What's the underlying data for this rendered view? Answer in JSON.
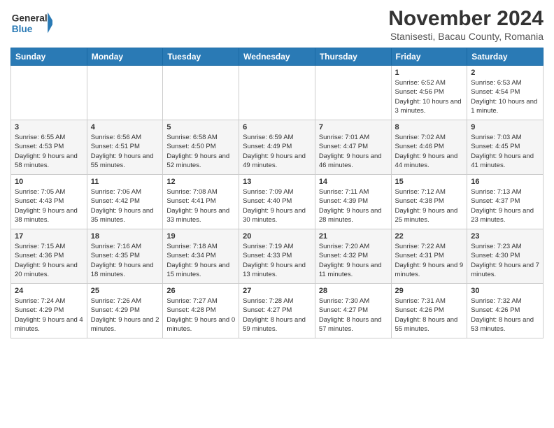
{
  "logo": {
    "line1": "General",
    "line2": "Blue"
  },
  "title": "November 2024",
  "subtitle": "Stanisesti, Bacau County, Romania",
  "days_of_week": [
    "Sunday",
    "Monday",
    "Tuesday",
    "Wednesday",
    "Thursday",
    "Friday",
    "Saturday"
  ],
  "weeks": [
    [
      {
        "day": "",
        "info": ""
      },
      {
        "day": "",
        "info": ""
      },
      {
        "day": "",
        "info": ""
      },
      {
        "day": "",
        "info": ""
      },
      {
        "day": "",
        "info": ""
      },
      {
        "day": "1",
        "info": "Sunrise: 6:52 AM\nSunset: 4:56 PM\nDaylight: 10 hours and 3 minutes."
      },
      {
        "day": "2",
        "info": "Sunrise: 6:53 AM\nSunset: 4:54 PM\nDaylight: 10 hours and 1 minute."
      }
    ],
    [
      {
        "day": "3",
        "info": "Sunrise: 6:55 AM\nSunset: 4:53 PM\nDaylight: 9 hours and 58 minutes."
      },
      {
        "day": "4",
        "info": "Sunrise: 6:56 AM\nSunset: 4:51 PM\nDaylight: 9 hours and 55 minutes."
      },
      {
        "day": "5",
        "info": "Sunrise: 6:58 AM\nSunset: 4:50 PM\nDaylight: 9 hours and 52 minutes."
      },
      {
        "day": "6",
        "info": "Sunrise: 6:59 AM\nSunset: 4:49 PM\nDaylight: 9 hours and 49 minutes."
      },
      {
        "day": "7",
        "info": "Sunrise: 7:01 AM\nSunset: 4:47 PM\nDaylight: 9 hours and 46 minutes."
      },
      {
        "day": "8",
        "info": "Sunrise: 7:02 AM\nSunset: 4:46 PM\nDaylight: 9 hours and 44 minutes."
      },
      {
        "day": "9",
        "info": "Sunrise: 7:03 AM\nSunset: 4:45 PM\nDaylight: 9 hours and 41 minutes."
      }
    ],
    [
      {
        "day": "10",
        "info": "Sunrise: 7:05 AM\nSunset: 4:43 PM\nDaylight: 9 hours and 38 minutes."
      },
      {
        "day": "11",
        "info": "Sunrise: 7:06 AM\nSunset: 4:42 PM\nDaylight: 9 hours and 35 minutes."
      },
      {
        "day": "12",
        "info": "Sunrise: 7:08 AM\nSunset: 4:41 PM\nDaylight: 9 hours and 33 minutes."
      },
      {
        "day": "13",
        "info": "Sunrise: 7:09 AM\nSunset: 4:40 PM\nDaylight: 9 hours and 30 minutes."
      },
      {
        "day": "14",
        "info": "Sunrise: 7:11 AM\nSunset: 4:39 PM\nDaylight: 9 hours and 28 minutes."
      },
      {
        "day": "15",
        "info": "Sunrise: 7:12 AM\nSunset: 4:38 PM\nDaylight: 9 hours and 25 minutes."
      },
      {
        "day": "16",
        "info": "Sunrise: 7:13 AM\nSunset: 4:37 PM\nDaylight: 9 hours and 23 minutes."
      }
    ],
    [
      {
        "day": "17",
        "info": "Sunrise: 7:15 AM\nSunset: 4:36 PM\nDaylight: 9 hours and 20 minutes."
      },
      {
        "day": "18",
        "info": "Sunrise: 7:16 AM\nSunset: 4:35 PM\nDaylight: 9 hours and 18 minutes."
      },
      {
        "day": "19",
        "info": "Sunrise: 7:18 AM\nSunset: 4:34 PM\nDaylight: 9 hours and 15 minutes."
      },
      {
        "day": "20",
        "info": "Sunrise: 7:19 AM\nSunset: 4:33 PM\nDaylight: 9 hours and 13 minutes."
      },
      {
        "day": "21",
        "info": "Sunrise: 7:20 AM\nSunset: 4:32 PM\nDaylight: 9 hours and 11 minutes."
      },
      {
        "day": "22",
        "info": "Sunrise: 7:22 AM\nSunset: 4:31 PM\nDaylight: 9 hours and 9 minutes."
      },
      {
        "day": "23",
        "info": "Sunrise: 7:23 AM\nSunset: 4:30 PM\nDaylight: 9 hours and 7 minutes."
      }
    ],
    [
      {
        "day": "24",
        "info": "Sunrise: 7:24 AM\nSunset: 4:29 PM\nDaylight: 9 hours and 4 minutes."
      },
      {
        "day": "25",
        "info": "Sunrise: 7:26 AM\nSunset: 4:29 PM\nDaylight: 9 hours and 2 minutes."
      },
      {
        "day": "26",
        "info": "Sunrise: 7:27 AM\nSunset: 4:28 PM\nDaylight: 9 hours and 0 minutes."
      },
      {
        "day": "27",
        "info": "Sunrise: 7:28 AM\nSunset: 4:27 PM\nDaylight: 8 hours and 59 minutes."
      },
      {
        "day": "28",
        "info": "Sunrise: 7:30 AM\nSunset: 4:27 PM\nDaylight: 8 hours and 57 minutes."
      },
      {
        "day": "29",
        "info": "Sunrise: 7:31 AM\nSunset: 4:26 PM\nDaylight: 8 hours and 55 minutes."
      },
      {
        "day": "30",
        "info": "Sunrise: 7:32 AM\nSunset: 4:26 PM\nDaylight: 8 hours and 53 minutes."
      }
    ]
  ]
}
